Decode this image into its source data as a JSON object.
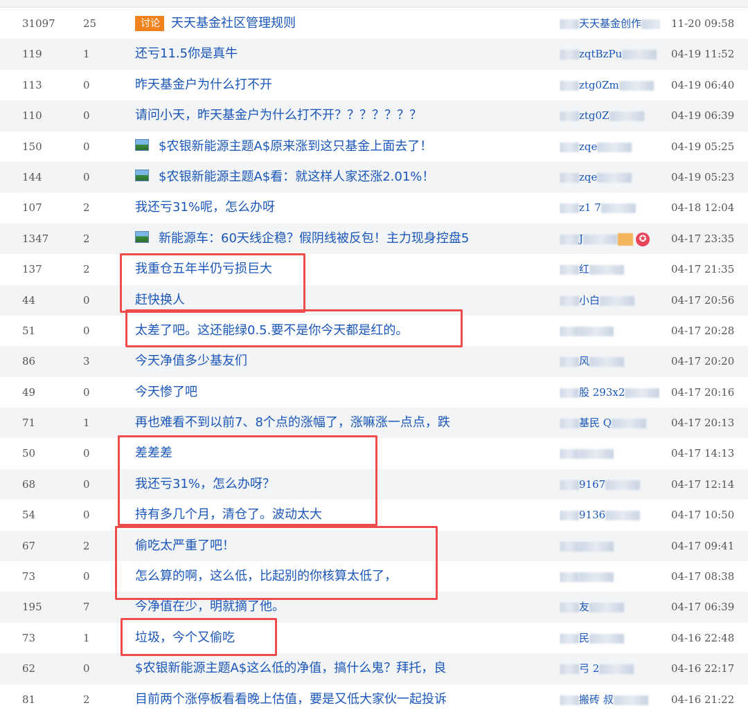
{
  "accent": "#1a56b8",
  "highlight_color": "#ee4b4b",
  "tag_label": "讨论",
  "rows": [
    {
      "reads": "31097",
      "replies": "25",
      "tag": "discuss",
      "title": "天天基金社区管理规则",
      "author": "天天基金创作",
      "author_blur": true,
      "time": "11-20 09:58"
    },
    {
      "reads": "119",
      "replies": "1",
      "title": "还亏11.5你是真牛",
      "author": "zqtBzPu",
      "author_blur": true,
      "time": "04-19 11:52"
    },
    {
      "reads": "113",
      "replies": "0",
      "title": "昨天基金户为什么打不开",
      "author": "ztg0Zm",
      "author_blur": true,
      "time": "04-19 06:40"
    },
    {
      "reads": "110",
      "replies": "0",
      "title": "请问小天，昨天基金户为什么打不开？？？？？？？",
      "author": "ztg0Z",
      "author_blur": true,
      "time": "04-19 06:39"
    },
    {
      "reads": "150",
      "replies": "0",
      "icon": true,
      "title": "$农银新能源主题A$原来涨到这只基金上面去了！",
      "author": "zqe",
      "author_blur": true,
      "time": "04-19 05:25"
    },
    {
      "reads": "144",
      "replies": "0",
      "icon": true,
      "title": "$农银新能源主题A$看：就这样人家还涨2.01%！",
      "author": "zqe",
      "author_blur": true,
      "time": "04-19 05:23"
    },
    {
      "reads": "107",
      "replies": "2",
      "title": "我还亏31%呢，怎么办呀",
      "author": "z1 7",
      "author_blur": true,
      "time": "04-18 12:04"
    },
    {
      "reads": "1347",
      "replies": "2",
      "icon": true,
      "title": "新能源车：60天线企稳？假阴线被反包！主力现身控盘5",
      "author": "J",
      "author_blur": true,
      "author_badge": "✪",
      "time": "04-17 23:35"
    },
    {
      "reads": "137",
      "replies": "2",
      "title": "我重仓五年半仍亏损巨大",
      "author": "红",
      "author_blur": true,
      "time": "04-17 21:35"
    },
    {
      "reads": "44",
      "replies": "0",
      "title": "赶快换人",
      "author": "小白",
      "author_blur": true,
      "time": "04-17 20:56"
    },
    {
      "reads": "51",
      "replies": "0",
      "title": "太差了吧。这还能绿0.5.要不是你今天都是红的。",
      "author": "",
      "author_blur": true,
      "time": "04-17 20:28"
    },
    {
      "reads": "86",
      "replies": "3",
      "title": "今天净值多少基友们",
      "author": "风",
      "author_blur": true,
      "time": "04-17 20:20"
    },
    {
      "reads": "49",
      "replies": "0",
      "title": "今天惨了吧",
      "author": "股 293x2",
      "author_blur": true,
      "time": "04-17 20:16"
    },
    {
      "reads": "71",
      "replies": "1",
      "title": "再也难看不到以前7、8个点的涨幅了，涨嘛涨一点点，跌",
      "author": "基民 Q",
      "author_blur": true,
      "time": "04-17 20:13"
    },
    {
      "reads": "50",
      "replies": "0",
      "title": "差差差",
      "author": "",
      "author_blur": true,
      "time": "04-17 14:13"
    },
    {
      "reads": "68",
      "replies": "0",
      "title": "我还亏31%，怎么办呀？",
      "author": "9167",
      "author_blur": true,
      "time": "04-17 12:14"
    },
    {
      "reads": "54",
      "replies": "0",
      "title": "持有多几个月，清仓了。波动太大",
      "author": "9136",
      "author_blur": true,
      "time": "04-17 10:50"
    },
    {
      "reads": "67",
      "replies": "2",
      "title": "偷吃太严重了吧！",
      "author": "",
      "author_blur": true,
      "time": "04-17 09:41"
    },
    {
      "reads": "73",
      "replies": "0",
      "title": "怎么算的啊，这么低，比起别的你核算太低了，",
      "author": "",
      "author_blur": true,
      "time": "04-17 08:38"
    },
    {
      "reads": "195",
      "replies": "7",
      "title": "今净值在少，明就摘了他。",
      "author": "友",
      "author_blur": true,
      "time": "04-17 06:39"
    },
    {
      "reads": "73",
      "replies": "1",
      "title": "垃圾，今个又偷吃",
      "author": "民",
      "author_blur": true,
      "time": "04-16 22:48"
    },
    {
      "reads": "62",
      "replies": "0",
      "title": "$农银新能源主题A$这么低的净值，搞什么鬼？拜托，良",
      "author": "弓 2",
      "author_blur": true,
      "time": "04-16 22:17"
    },
    {
      "reads": "81",
      "replies": "2",
      "title": "目前两个涨停板看看晚上估值，要是又低大家伙一起投诉",
      "author": "搬砖 叔",
      "author_blur": true,
      "time": "04-16 21:22"
    }
  ]
}
